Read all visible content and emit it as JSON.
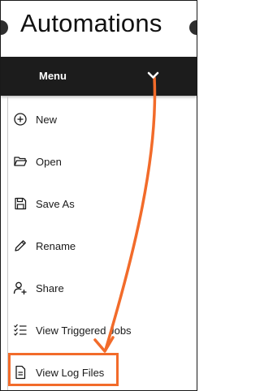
{
  "header": {
    "title": "Automations"
  },
  "menu": {
    "label": "Menu",
    "items": [
      {
        "label": "New",
        "icon": "plus-circle-icon"
      },
      {
        "label": "Open",
        "icon": "folder-open-icon"
      },
      {
        "label": "Save As",
        "icon": "save-icon"
      },
      {
        "label": "Rename",
        "icon": "pencil-icon"
      },
      {
        "label": "Share",
        "icon": "user-add-icon"
      },
      {
        "label": "View Triggered Jobs",
        "icon": "checklist-icon"
      },
      {
        "label": "View Log Files",
        "icon": "document-icon"
      }
    ]
  },
  "annotation": {
    "color": "#f26b2a",
    "target": "View Log Files"
  }
}
